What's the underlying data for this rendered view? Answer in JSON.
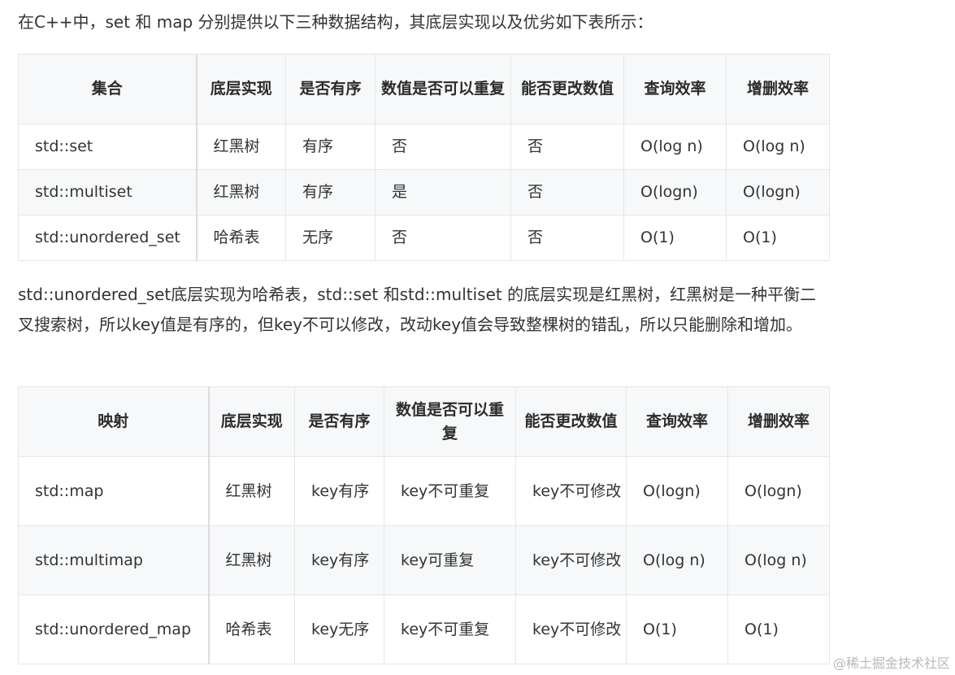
{
  "intro": "在C++中，set 和 map 分别提供以下三种数据结构，其底层实现以及优劣如下表所示：",
  "set_table": {
    "headers": [
      "集合",
      "底层实现",
      "是否有序",
      "数值是否可以重复",
      "能否更改数值",
      "查询效率",
      "增删效率"
    ],
    "rows": [
      [
        "std::set",
        "红黑树",
        "有序",
        "否",
        "否",
        "O(log n)",
        "O(log n)"
      ],
      [
        "std::multiset",
        "红黑树",
        "有序",
        "是",
        "否",
        "O(logn)",
        "O(logn)"
      ],
      [
        "std::unordered_set",
        "哈希表",
        "无序",
        "否",
        "否",
        "O(1)",
        "O(1)"
      ]
    ]
  },
  "explanation": "std::unordered_set底层实现为哈希表，std::set 和std::multiset 的底层实现是红黑树，红黑树是一种平衡二叉搜索树，所以key值是有序的，但key不可以修改，改动key值会导致整棵树的错乱，所以只能删除和增加。",
  "map_table": {
    "headers": [
      "映射",
      "底层实现",
      "是否有序",
      "数值是否可以重复",
      "能否更改数值",
      "查询效率",
      "增删效率"
    ],
    "rows": [
      [
        "std::map",
        "红黑树",
        "key有序",
        "key不可重复",
        "key不可修改",
        "O(logn)",
        "O(logn)"
      ],
      [
        "std::multimap",
        "红黑树",
        "key有序",
        "key可重复",
        "key不可修改",
        "O(log n)",
        "O(log n)"
      ],
      [
        "std::unordered_map",
        "哈希表",
        "key无序",
        "key不可重复",
        "key不可修改",
        "O(1)",
        "O(1)"
      ]
    ]
  },
  "watermark": "@稀土掘金技术社区"
}
